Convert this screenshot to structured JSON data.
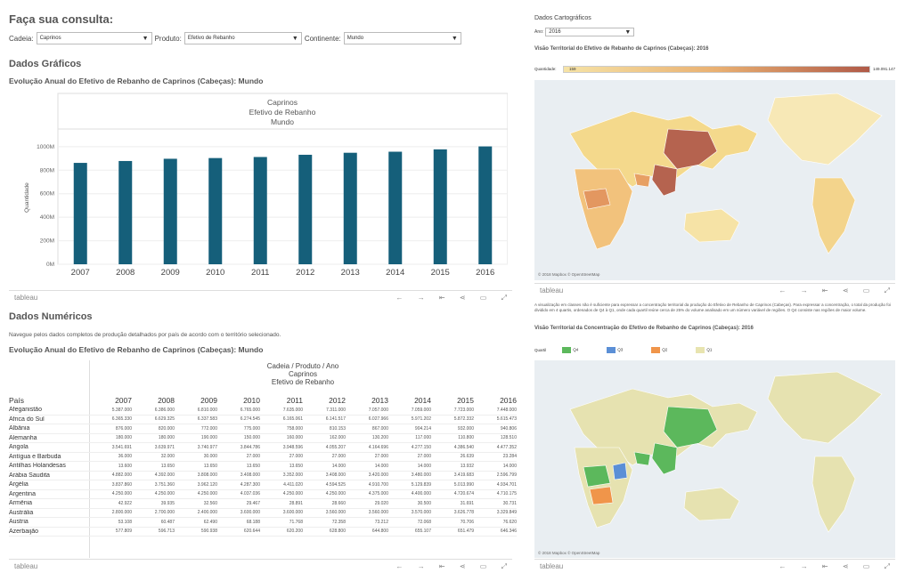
{
  "header": {
    "title": "Faça sua consulta:"
  },
  "filters": {
    "cadeia_label": "Cadeia:",
    "cadeia_value": "Caprinos",
    "produto_label": "Produto:",
    "produto_value": "Efetivo de Rebanho",
    "continente_label": "Continente:",
    "continente_value": "Mundo"
  },
  "graficos": {
    "section_title": "Dados Gráficos",
    "chart_title": "Evolução Anual do Efetivo de Rebanho de Caprinos (Cabeças): Mundo",
    "header_lines": [
      "Caprinos",
      "Efetivo de Rebanho",
      "Mundo"
    ]
  },
  "chart_data": {
    "type": "bar",
    "categories": [
      "2007",
      "2008",
      "2009",
      "2010",
      "2011",
      "2012",
      "2013",
      "2014",
      "2015",
      "2016"
    ],
    "values": [
      862,
      878,
      897,
      903,
      912,
      931,
      948,
      957,
      977,
      1002
    ],
    "ylabel": "Quantidade",
    "yticks": [
      "0M",
      "200M",
      "400M",
      "600M",
      "800M",
      "1000M"
    ],
    "ylim": [
      0,
      1150
    ],
    "color": "#155f7a",
    "grid": true
  },
  "toolbar": {
    "logo": "tableau",
    "icons": [
      "←",
      "→",
      "⇤",
      "⋖",
      "▭",
      "⤢"
    ]
  },
  "numericos": {
    "section_title": "Dados Numéricos",
    "note": "Navegue pelos dados completos de produção detalhados por país de acordo com o território selecionado.",
    "table_title": "Evolução Anual do Efetivo de Rebanho de Caprinos (Cabeças): Mundo",
    "head_lines": [
      "Cadeia / Produto / Ano",
      "Caprinos",
      "Efetivo de Rebanho"
    ],
    "pais_label": "País",
    "years": [
      "2007",
      "2008",
      "2009",
      "2010",
      "2011",
      "2012",
      "2013",
      "2014",
      "2015",
      "2016"
    ],
    "rows": [
      {
        "name": "Afeganistão",
        "v": [
          "5.387.000",
          "6.386.000",
          "6.810.000",
          "6.765.000",
          "7.635.000",
          "7.311.000",
          "7.057.000",
          "7.059.000",
          "7.723.000",
          "7.448.000"
        ]
      },
      {
        "name": "África do Sul",
        "v": [
          "6.365.330",
          "6.629.325",
          "6.337.583",
          "6.274.545",
          "6.165.061",
          "6.141.517",
          "6.027.966",
          "5.971.202",
          "5.872.332",
          "5.615.473"
        ]
      },
      {
        "name": "Albânia",
        "v": [
          "876.000",
          "820.000",
          "772.000",
          "775.000",
          "758.000",
          "810.153",
          "867.000",
          "904.214",
          "932.000",
          "940.806"
        ]
      },
      {
        "name": "Alemanha",
        "v": [
          "180.000",
          "180.000",
          "190.000",
          "150.000",
          "160.000",
          "162.000",
          "130.200",
          "117.000",
          "110.800",
          "128.510"
        ]
      },
      {
        "name": "Angola",
        "v": [
          "3.541.691",
          "3.639.971",
          "3.740.977",
          "3.844.786",
          "3.948.596",
          "4.055.207",
          "4.164.696",
          "4.277.150",
          "4.386.540",
          "4.477.352"
        ]
      },
      {
        "name": "Antígua e Barbuda",
        "v": [
          "36.000",
          "32.000",
          "30.000",
          "27.000",
          "27.000",
          "27.000",
          "27.000",
          "27.000",
          "26.639",
          "23.284"
        ]
      },
      {
        "name": "Antilhas Holandesas",
        "v": [
          "13.600",
          "13.650",
          "13.650",
          "13.650",
          "13.650",
          "14.000",
          "14.000",
          "14.000",
          "13.932",
          "14.000"
        ]
      },
      {
        "name": "Arábia Saudita",
        "v": [
          "4.882.000",
          "4.392.000",
          "3.808.000",
          "3.408.000",
          "3.352.000",
          "3.408.000",
          "3.420.000",
          "3.480.000",
          "3.419.683",
          "2.596.799"
        ]
      },
      {
        "name": "Argélia",
        "v": [
          "3.837.860",
          "3.751.360",
          "3.962.120",
          "4.287.300",
          "4.411.020",
          "4.594.525",
          "4.910.700",
          "5.129.839",
          "5.013.990",
          "4.934.701"
        ]
      },
      {
        "name": "Argentina",
        "v": [
          "4.250.000",
          "4.250.000",
          "4.250.000",
          "4.037.036",
          "4.250.000",
          "4.250.000",
          "4.375.000",
          "4.400.000",
          "4.720.674",
          "4.710.175"
        ]
      },
      {
        "name": "Armênia",
        "v": [
          "42.922",
          "39.935",
          "32.560",
          "29.467",
          "28.891",
          "28.660",
          "29.020",
          "30.500",
          "31.691",
          "30.731"
        ]
      },
      {
        "name": "Austrália",
        "v": [
          "2.800.000",
          "2.700.000",
          "2.400.000",
          "3.600.000",
          "3.600.000",
          "3.560.000",
          "3.560.000",
          "3.570.000",
          "3.626.778",
          "3.329.849"
        ]
      },
      {
        "name": "Áustria",
        "v": [
          "53.108",
          "60.487",
          "62.490",
          "68.188",
          "71.768",
          "72.358",
          "73.212",
          "72.068",
          "70.706",
          "76.620"
        ]
      },
      {
        "name": "Azerbaijão",
        "v": [
          "577.809",
          "596.713",
          "590.938",
          "620.644",
          "620.200",
          "628.800",
          "644.800",
          "655.107",
          "651.479",
          "646.346"
        ]
      }
    ]
  },
  "carto": {
    "title": "Dados Cartográficos",
    "ano_label": "Ano:",
    "ano_value": "2016",
    "map1_title": "Visão Territorial do Efetivo de Rebanho de Caprinos (Cabeças): 2016",
    "qty_label": "Quantidade:",
    "qty_min": "159",
    "qty_max": "149.091.147",
    "desc": "A visualização em classes não é suficiente para expressar a concentração territorial da produção do Efetivo de Rebanho de Caprinos (Cabeças). Para expressar a concentração, o total da produção foi dividido em 4 quartis, ordenados de Q4 à Q1, onde cada quartil reúne cerca de 25% do volume analisado em um número variável de regiões. O Q4 consiste nas regiões de maior volume.",
    "map2_title": "Visão Territorial da Concentração do Efetivo de Rebanho de Caprinos (Cabeças): 2016",
    "quartil_label": "Quartil",
    "quartis": [
      {
        "label": "Q4",
        "color": "#5cb85c"
      },
      {
        "label": "Q3",
        "color": "#5b8fd6"
      },
      {
        "label": "Q2",
        "color": "#f0954a"
      },
      {
        "label": "Q1",
        "color": "#e8e4b0"
      }
    ],
    "attribution": "© 2018 Mapbox © OpenStreetMap"
  }
}
